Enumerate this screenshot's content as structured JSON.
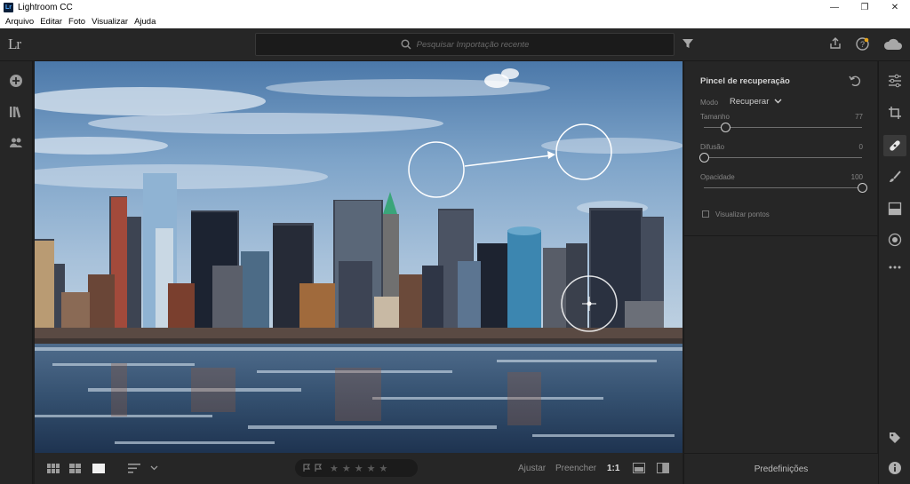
{
  "window": {
    "title": "Lightroom CC",
    "app_icon_text": "Lr"
  },
  "window_controls": {
    "minimize": "—",
    "maximize": "❐",
    "close": "✕"
  },
  "menu": [
    "Arquivo",
    "Editar",
    "Foto",
    "Visualizar",
    "Ajuda"
  ],
  "topbar": {
    "logo": "Lr",
    "search_placeholder": "Pesquisar Importação recente"
  },
  "left_rail_icons": [
    "add-icon",
    "library-icon",
    "people-icon"
  ],
  "panel": {
    "title": "Pincel de recuperação",
    "mode_label": "Modo",
    "mode_value": "Recuperar",
    "sliders": [
      {
        "label": "Tamanho",
        "value": "77",
        "fraction": 0.14
      },
      {
        "label": "Difusão",
        "value": "0",
        "fraction": 0.0
      },
      {
        "label": "Opacidade",
        "value": "100",
        "fraction": 1.0
      }
    ],
    "show_spots_label": "Visualizar pontos",
    "presets_label": "Predefinições"
  },
  "bottombar": {
    "fit_label": "Ajustar",
    "fill_label": "Preencher",
    "one_to_one_label": "1:1",
    "rating_stars": "★★★★★"
  },
  "right_rail_icons": [
    "sliders-icon",
    "crop-icon",
    "bandage-icon",
    "brush-icon",
    "linear-gradient-icon",
    "radial-gradient-icon",
    "more-icon",
    "tag-icon",
    "info-icon"
  ],
  "colors": {
    "accent": "#d0d0d0",
    "background": "#1e1e1e",
    "panel": "#262626"
  }
}
